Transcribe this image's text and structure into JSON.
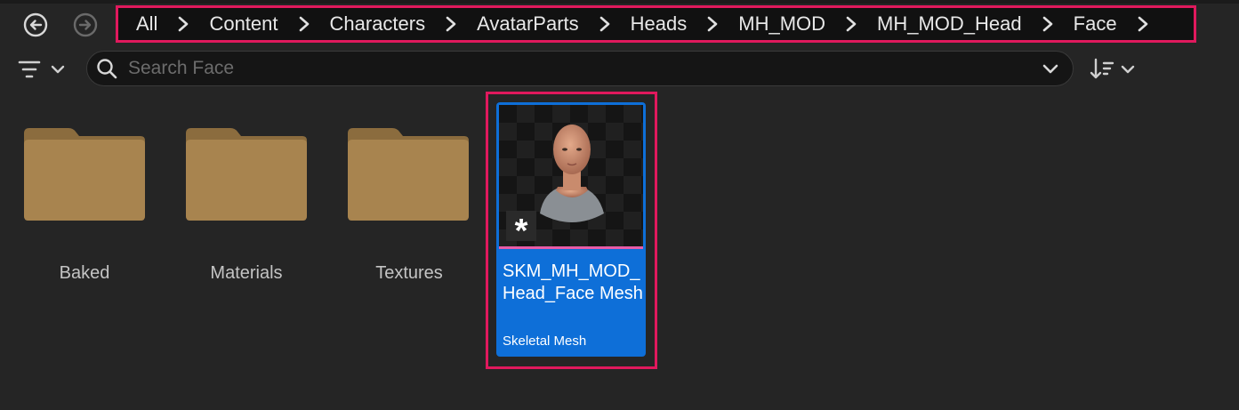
{
  "nav": {
    "back_icon": "arrow-left-circle-icon",
    "forward_icon": "arrow-right-circle-icon"
  },
  "breadcrumb": {
    "items": [
      "All",
      "Content",
      "Characters",
      "AvatarParts",
      "Heads",
      "MH_MOD",
      "MH_MOD_Head",
      "Face"
    ],
    "separator_icon": "chevron-right-icon"
  },
  "toolbar": {
    "filter_icon": "filter-icon",
    "search_placeholder": "Search Face",
    "search_value": "",
    "sort_icon": "sort-icon"
  },
  "folders": [
    {
      "label": "Baked"
    },
    {
      "label": "Materials"
    },
    {
      "label": "Textures"
    }
  ],
  "asset": {
    "name": "SKM_MH_MOD_Head_Face Mesh",
    "type": "Skeletal Mesh",
    "badge": "*",
    "thumbnail": "head-bust-thumbnail"
  },
  "colors": {
    "highlight": "#e0195d",
    "selection": "#0e6fd8",
    "folder": "#a8844f",
    "background": "#252525"
  }
}
